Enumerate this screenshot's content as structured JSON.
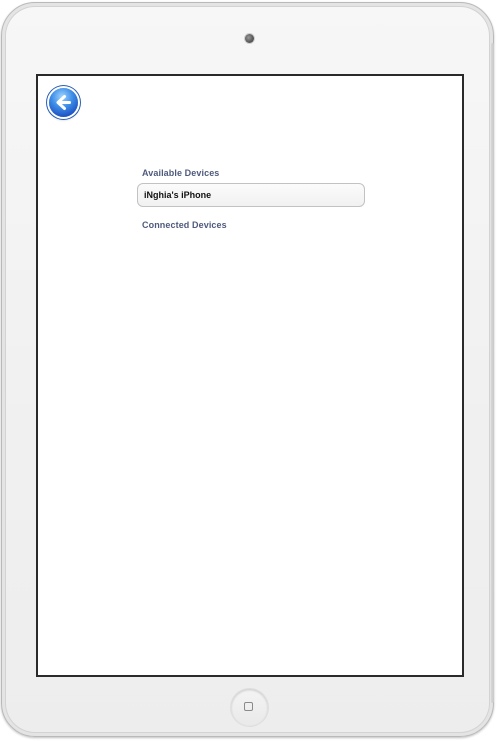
{
  "screen": {
    "back_icon": "back-arrow-icon",
    "sections": {
      "available_label": "Available Devices",
      "connected_label": "Connected Devices"
    },
    "available_devices": [
      {
        "name": "iNghia's iPhone"
      }
    ],
    "connected_devices": []
  },
  "hardware": {
    "camera_icon": "camera-icon",
    "home_icon": "home-button-icon"
  },
  "colors": {
    "section_label": "#4f5b7d",
    "back_button_blue": "#2a6fd8",
    "screen_border": "#2a2a2a"
  }
}
